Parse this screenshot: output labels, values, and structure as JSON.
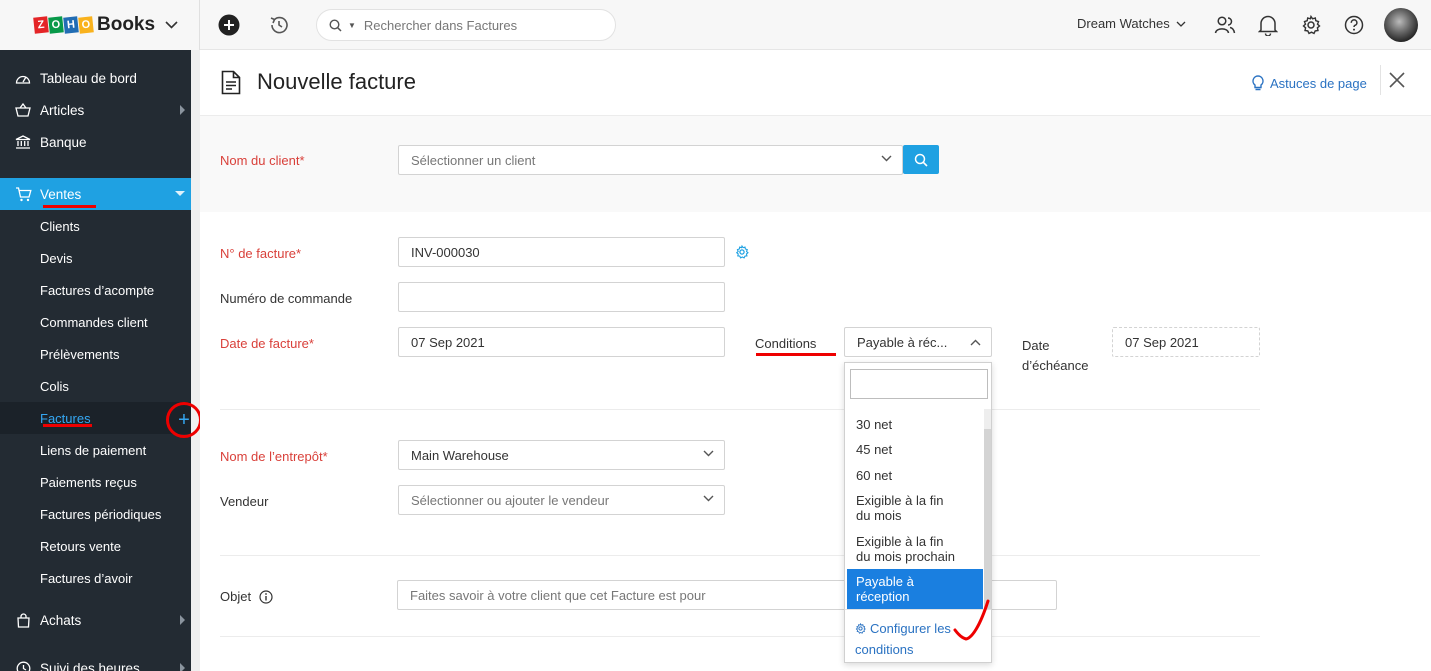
{
  "brand": {
    "logo_letters": [
      "Z",
      "O",
      "H",
      "O"
    ],
    "logo_colors": [
      "#e42527",
      "#089949",
      "#226db4",
      "#f9b21d"
    ],
    "name": "Books"
  },
  "topbar": {
    "search_placeholder": "Rechercher dans Factures",
    "org_name": "Dream Watches",
    "icons": [
      "plus-circle-icon",
      "history-icon",
      "search-icon",
      "users-icon",
      "bell-icon",
      "gear-icon",
      "help-icon"
    ]
  },
  "sidebar": {
    "items": [
      {
        "label": "Tableau de bord",
        "icon": "dashboard-icon"
      },
      {
        "label": "Articles",
        "icon": "basket-icon",
        "has_arrow": true
      },
      {
        "label": "Banque",
        "icon": "bank-icon"
      },
      {
        "label": "Ventes",
        "icon": "cart-icon",
        "active": true
      },
      {
        "label": "Achats",
        "icon": "bag-icon",
        "has_arrow": true
      },
      {
        "label": "Suivi des heures",
        "icon": "clock-icon",
        "has_arrow": true
      }
    ],
    "sales_subitems": [
      "Clients",
      "Devis",
      "Factures d’acompte",
      "Commandes client",
      "Prélèvements",
      "Colis",
      "Factures",
      "Liens de paiement",
      "Paiements reçus",
      "Factures périodiques",
      "Retours vente",
      "Factures d’avoir"
    ],
    "active_subitem": "Factures"
  },
  "page": {
    "title": "Nouvelle facture",
    "tips_label": "Astuces de page"
  },
  "form": {
    "client_label": "Nom du client*",
    "client_placeholder": "Sélectionner un client",
    "invoice_no_label": "N° de facture*",
    "invoice_no_value": "INV-000030",
    "order_no_label": "Numéro de commande",
    "order_no_value": "",
    "invoice_date_label": "Date de facture*",
    "invoice_date_value": "07 Sep 2021",
    "terms_label": "Conditions",
    "terms_value": "Payable à réc...",
    "due_label_1": "Date",
    "due_label_2": "d’échéance",
    "due_value": "07 Sep 2021",
    "warehouse_label": "Nom de l’entrepôt*",
    "warehouse_value": "Main Warehouse",
    "seller_label": "Vendeur",
    "seller_placeholder": "Sélectionner ou ajouter le vendeur",
    "subject_label": "Objet",
    "subject_placeholder": "Faites savoir à votre client que cet Facture est pour"
  },
  "terms_dropdown": {
    "search_value": "",
    "options": [
      {
        "line1": "30 net"
      },
      {
        "line1": "45 net"
      },
      {
        "line1": "60 net"
      },
      {
        "line1": "Exigible à la fin",
        "line2": "du mois"
      },
      {
        "line1": "Exigible à la fin",
        "line2": "du mois prochain"
      },
      {
        "line1": "Payable à",
        "line2": "réception",
        "selected": true
      }
    ],
    "config_line1": "Configurer les",
    "config_line2": "conditions"
  },
  "colors": {
    "accent": "#1fa1e2",
    "sidebar_bg": "#232b33",
    "required": "#d9403a",
    "annotation": "#e00000",
    "link": "#2a72c2"
  }
}
